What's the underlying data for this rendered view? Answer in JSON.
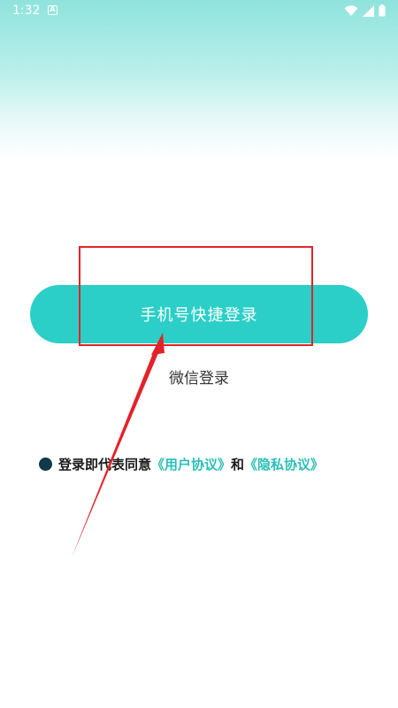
{
  "status_bar": {
    "time": "1:32",
    "notification_letter": "A"
  },
  "login": {
    "phone_login_label": "手机号快捷登录",
    "wechat_login_label": "微信登录"
  },
  "agreement": {
    "prefix": "登录即代表同意",
    "user_agreement": "《用户协议》",
    "conjunction": "和",
    "privacy_policy": "《隐私协议》"
  },
  "colors": {
    "accent": "#2bcfc7",
    "link": "#2bbfb8",
    "radio": "#0f3a48",
    "annotation": "#e2232a"
  },
  "icons": [
    "wifi-icon",
    "signal-icon",
    "battery-icon",
    "notification-a-icon",
    "radio-dot-icon"
  ]
}
